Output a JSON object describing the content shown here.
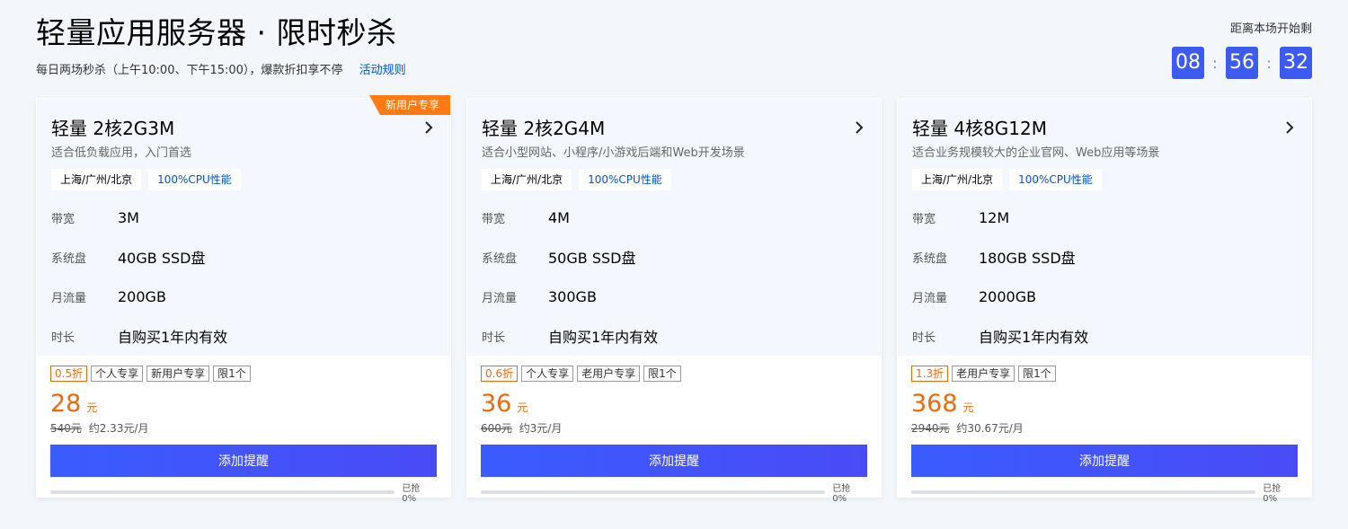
{
  "header": {
    "title": "轻量应用服务器 · 限时秒杀",
    "subtitle": "每日两场秒杀（上午10:00、下午15:00），爆款折扣享不停",
    "rules_link": "活动规则"
  },
  "countdown": {
    "label": "距离本场开始剩",
    "hours": "08",
    "minutes": "56",
    "seconds": "32",
    "separator": ":"
  },
  "colors": {
    "accent": "#3d5af1",
    "price": "#ed6a0c",
    "ribbon": "#ff7a12"
  },
  "cards": [
    {
      "ribbon": "新用户专享",
      "title": "轻量 2核2G3M",
      "desc": "适合低负载应用，入门首选",
      "region_tag": "上海/广州/北京",
      "cpu_tag": "100%CPU性能",
      "specs": [
        {
          "label": "带宽",
          "value": "3M"
        },
        {
          "label": "系统盘",
          "value": "40GB SSD盘"
        },
        {
          "label": "月流量",
          "value": "200GB"
        },
        {
          "label": "时长",
          "value": "自购买1年内有效"
        }
      ],
      "badges": [
        "0.5折",
        "个人专享",
        "新用户专享",
        "限1个"
      ],
      "price": "28",
      "unit": "元",
      "original": "540元",
      "monthly": "约2.33元/月",
      "button": "添加提醒",
      "progress_percent": 0,
      "progress_text": "已抢 0%"
    },
    {
      "ribbon": "",
      "title": "轻量 2核2G4M",
      "desc": "适合小型网站、小程序/小游戏后端和Web开发场景",
      "region_tag": "上海/广州/北京",
      "cpu_tag": "100%CPU性能",
      "specs": [
        {
          "label": "带宽",
          "value": "4M"
        },
        {
          "label": "系统盘",
          "value": "50GB SSD盘"
        },
        {
          "label": "月流量",
          "value": "300GB"
        },
        {
          "label": "时长",
          "value": "自购买1年内有效"
        }
      ],
      "badges": [
        "0.6折",
        "个人专享",
        "老用户专享",
        "限1个"
      ],
      "price": "36",
      "unit": "元",
      "original": "600元",
      "monthly": "约3元/月",
      "button": "添加提醒",
      "progress_percent": 0,
      "progress_text": "已抢 0%"
    },
    {
      "ribbon": "",
      "title": "轻量 4核8G12M",
      "desc": "适合业务规模较大的企业官网、Web应用等场景",
      "region_tag": "上海/广州/北京",
      "cpu_tag": "100%CPU性能",
      "specs": [
        {
          "label": "带宽",
          "value": "12M"
        },
        {
          "label": "系统盘",
          "value": "180GB SSD盘"
        },
        {
          "label": "月流量",
          "value": "2000GB"
        },
        {
          "label": "时长",
          "value": "自购买1年内有效"
        }
      ],
      "badges": [
        "1.3折",
        "老用户专享",
        "限1个"
      ],
      "price": "368",
      "unit": "元",
      "original": "2940元",
      "monthly": "约30.67元/月",
      "button": "添加提醒",
      "progress_percent": 0,
      "progress_text": "已抢 0%"
    }
  ]
}
